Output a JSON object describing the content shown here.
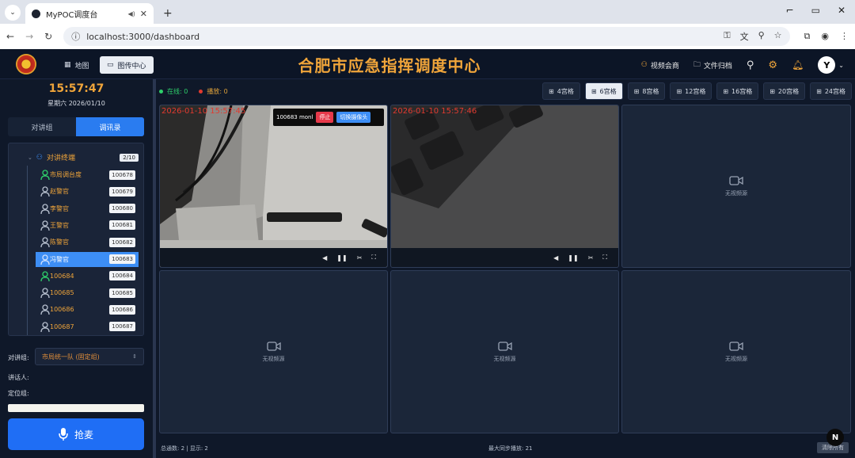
{
  "browser": {
    "tab_title": "MyPOC调度台",
    "url": "localhost:3000/dashboard"
  },
  "header": {
    "title": "合肥市应急指挥调度中心",
    "nav": [
      {
        "label": "地图",
        "active": false
      },
      {
        "label": "图传中心",
        "active": true
      }
    ],
    "right": [
      {
        "label": "视频会商",
        "icon": "users-icon"
      },
      {
        "label": "文件归档",
        "icon": "folder-icon"
      }
    ],
    "accent_color": "#f0a53a"
  },
  "sidebar": {
    "clock": "15:57:47",
    "date": "星期六 2026/01/10",
    "segments": [
      {
        "label": "对讲组",
        "active": false
      },
      {
        "label": "调讯录",
        "active": true
      }
    ],
    "group": {
      "name": "对讲终端",
      "count": "2/10"
    },
    "members": [
      {
        "name": "市局调台度",
        "id": "100678",
        "online": true
      },
      {
        "name": "赵警官",
        "id": "100679",
        "online": false
      },
      {
        "name": "李警官",
        "id": "100680",
        "online": false
      },
      {
        "name": "王警官",
        "id": "100681",
        "online": false
      },
      {
        "name": "陈警官",
        "id": "100682",
        "online": false
      },
      {
        "name": "冯警官",
        "id": "100683",
        "online": false,
        "selected": true
      },
      {
        "name": "100684",
        "id": "100684",
        "online": true
      },
      {
        "name": "100685",
        "id": "100685",
        "online": false
      },
      {
        "name": "100686",
        "id": "100686",
        "online": false
      },
      {
        "name": "100687",
        "id": "100687",
        "online": false
      }
    ],
    "talk_group_label": "对讲组:",
    "talk_group_value": "市局统一队 (固定组)",
    "speaker_label": "讲话人:",
    "locate_label": "定位组:",
    "ptt_label": "抢麦"
  },
  "main": {
    "status_online": "在线: 0",
    "status_busy": "播放: 0",
    "layouts": [
      {
        "label": "4宫格",
        "active": false
      },
      {
        "label": "6宫格",
        "active": true
      },
      {
        "label": "8宫格",
        "active": false
      },
      {
        "label": "12宫格",
        "active": false
      },
      {
        "label": "16宫格",
        "active": false
      },
      {
        "label": "20宫格",
        "active": false
      },
      {
        "label": "24宫格",
        "active": false
      }
    ],
    "cells": [
      {
        "timestamp": "2026-01-10 15:57:45",
        "overlay": {
          "id": "100683 monl",
          "stop": "停止",
          "switch": "切换摄像头"
        }
      },
      {
        "timestamp": "2026-01-10 15:57:46"
      },
      {
        "empty": "无视频源"
      },
      {
        "empty": "无视频源"
      },
      {
        "empty": "无视频源"
      },
      {
        "empty": "无视频源"
      }
    ],
    "footer_left": "总通数: 2 | 显示: 2",
    "footer_mid": "最大同步播放: 21",
    "footer_btn": "清除所有",
    "n_badge": "N"
  }
}
